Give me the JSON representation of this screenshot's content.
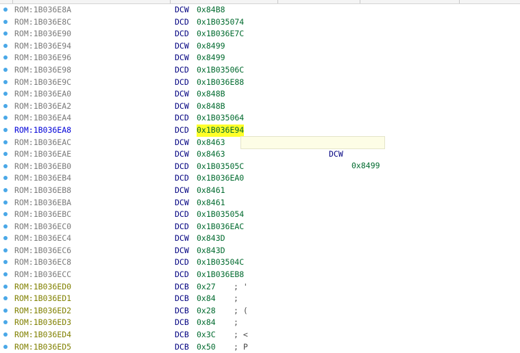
{
  "colors": {
    "address_normal": "#7a7a7a",
    "address_selected": "#0000d8",
    "address_data": "#808000",
    "mnemonic": "#000080",
    "operand": "#006a2e",
    "highlight": "#ffff2a",
    "line_marker": "#4aa8e8",
    "tooltip_bg": "#fdfde6"
  },
  "tooltip": {
    "mnemonic": "DCW",
    "operand": "0x8499"
  },
  "rows": [
    {
      "address": "ROM:1B036E8A",
      "mnemonic": "DCW",
      "operand": "0x84B8",
      "comment": "",
      "kind": "normal"
    },
    {
      "address": "ROM:1B036E8C",
      "mnemonic": "DCD",
      "operand": "0x1B035074",
      "comment": "",
      "kind": "normal"
    },
    {
      "address": "ROM:1B036E90",
      "mnemonic": "DCD",
      "operand": "0x1B036E7C",
      "comment": "",
      "kind": "normal"
    },
    {
      "address": "ROM:1B036E94",
      "mnemonic": "DCW",
      "operand": "0x8499",
      "comment": "",
      "kind": "normal"
    },
    {
      "address": "ROM:1B036E96",
      "mnemonic": "DCW",
      "operand": "0x8499",
      "comment": "",
      "kind": "normal"
    },
    {
      "address": "ROM:1B036E98",
      "mnemonic": "DCD",
      "operand": "0x1B03506C",
      "comment": "",
      "kind": "normal"
    },
    {
      "address": "ROM:1B036E9C",
      "mnemonic": "DCD",
      "operand": "0x1B036E88",
      "comment": "",
      "kind": "normal"
    },
    {
      "address": "ROM:1B036EA0",
      "mnemonic": "DCW",
      "operand": "0x848B",
      "comment": "",
      "kind": "normal"
    },
    {
      "address": "ROM:1B036EA2",
      "mnemonic": "DCW",
      "operand": "0x848B",
      "comment": "",
      "kind": "normal"
    },
    {
      "address": "ROM:1B036EA4",
      "mnemonic": "DCD",
      "operand": "0x1B035064",
      "comment": "",
      "kind": "normal"
    },
    {
      "address": "ROM:1B036EA8",
      "mnemonic": "DCD",
      "operand": "0x1B036E94",
      "comment": "",
      "kind": "selected"
    },
    {
      "address": "ROM:1B036EAC",
      "mnemonic": "DCW",
      "operand": "0x8463",
      "comment": "",
      "kind": "normal"
    },
    {
      "address": "ROM:1B036EAE",
      "mnemonic": "DCW",
      "operand": "0x8463",
      "comment": "",
      "kind": "normal"
    },
    {
      "address": "ROM:1B036EB0",
      "mnemonic": "DCD",
      "operand": "0x1B03505C",
      "comment": "",
      "kind": "normal"
    },
    {
      "address": "ROM:1B036EB4",
      "mnemonic": "DCD",
      "operand": "0x1B036EA0",
      "comment": "",
      "kind": "normal"
    },
    {
      "address": "ROM:1B036EB8",
      "mnemonic": "DCW",
      "operand": "0x8461",
      "comment": "",
      "kind": "normal"
    },
    {
      "address": "ROM:1B036EBA",
      "mnemonic": "DCW",
      "operand": "0x8461",
      "comment": "",
      "kind": "normal"
    },
    {
      "address": "ROM:1B036EBC",
      "mnemonic": "DCD",
      "operand": "0x1B035054",
      "comment": "",
      "kind": "normal"
    },
    {
      "address": "ROM:1B036EC0",
      "mnemonic": "DCD",
      "operand": "0x1B036EAC",
      "comment": "",
      "kind": "normal"
    },
    {
      "address": "ROM:1B036EC4",
      "mnemonic": "DCW",
      "operand": "0x843D",
      "comment": "",
      "kind": "normal"
    },
    {
      "address": "ROM:1B036EC6",
      "mnemonic": "DCW",
      "operand": "0x843D",
      "comment": "",
      "kind": "normal"
    },
    {
      "address": "ROM:1B036EC8",
      "mnemonic": "DCD",
      "operand": "0x1B03504C",
      "comment": "",
      "kind": "normal"
    },
    {
      "address": "ROM:1B036ECC",
      "mnemonic": "DCD",
      "operand": "0x1B036EB8",
      "comment": "",
      "kind": "normal"
    },
    {
      "address": "ROM:1B036ED0",
      "mnemonic": "DCB",
      "operand": "0x27",
      "comment": "; '",
      "kind": "data"
    },
    {
      "address": "ROM:1B036ED1",
      "mnemonic": "DCB",
      "operand": "0x84",
      "comment": ";",
      "kind": "data"
    },
    {
      "address": "ROM:1B036ED2",
      "mnemonic": "DCB",
      "operand": "0x28",
      "comment": "; (",
      "kind": "data"
    },
    {
      "address": "ROM:1B036ED3",
      "mnemonic": "DCB",
      "operand": "0x84",
      "comment": ";",
      "kind": "data"
    },
    {
      "address": "ROM:1B036ED4",
      "mnemonic": "DCB",
      "operand": "0x3C",
      "comment": "; <",
      "kind": "data"
    },
    {
      "address": "ROM:1B036ED5",
      "mnemonic": "DCB",
      "operand": "0x50",
      "comment": "; P",
      "kind": "data"
    }
  ]
}
